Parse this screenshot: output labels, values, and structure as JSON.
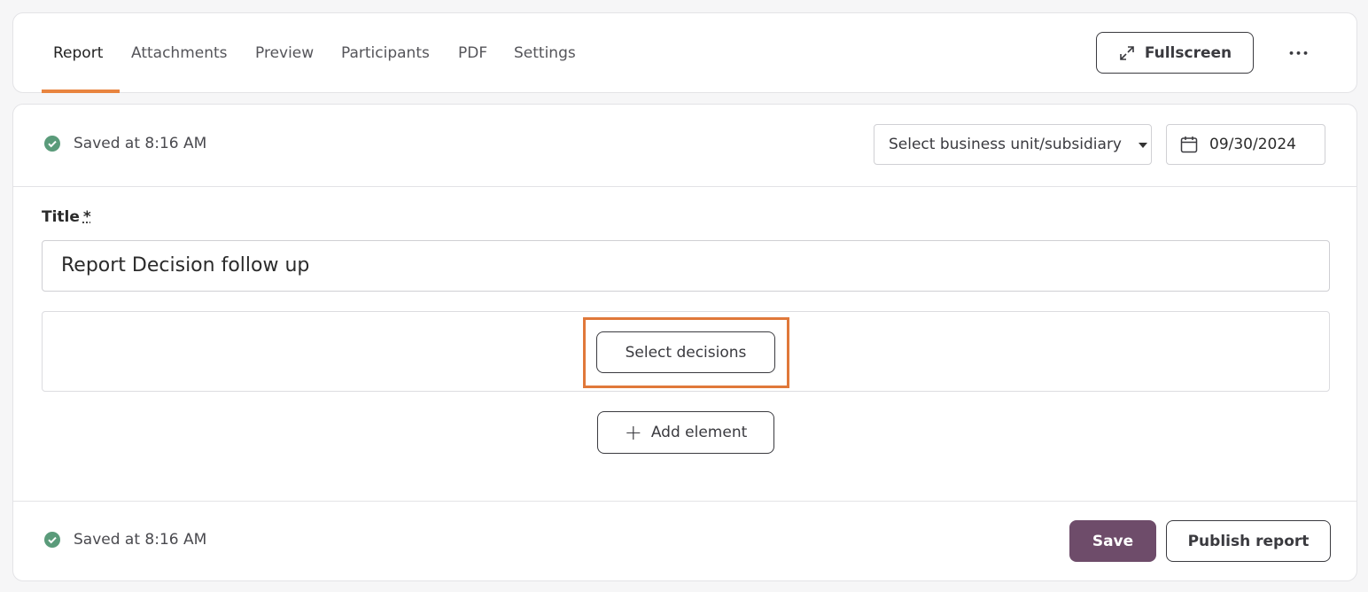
{
  "tabs": [
    {
      "label": "Report",
      "active": true
    },
    {
      "label": "Attachments"
    },
    {
      "label": "Preview"
    },
    {
      "label": "Participants"
    },
    {
      "label": "PDF"
    },
    {
      "label": "Settings"
    }
  ],
  "toolbar": {
    "fullscreen_label": "Fullscreen",
    "more_label": "•••"
  },
  "header": {
    "saved_status": "Saved at 8:16 AM",
    "business_unit_select": "Select business unit/subsidiary",
    "date_value": "09/30/2024"
  },
  "form": {
    "title_label": "Title",
    "title_required_marker": "*",
    "title_value": "Report Decision follow up",
    "select_decisions_label": "Select decisions",
    "add_element_label": "Add element",
    "add_element_plus": "+"
  },
  "footer": {
    "saved_status": "Saved at 8:16 AM",
    "save_label": "Save",
    "publish_label": "Publish report"
  },
  "colors": {
    "accent": "#e8843f",
    "primary_button": "#6e4c6a",
    "success": "#5a9b7a"
  }
}
